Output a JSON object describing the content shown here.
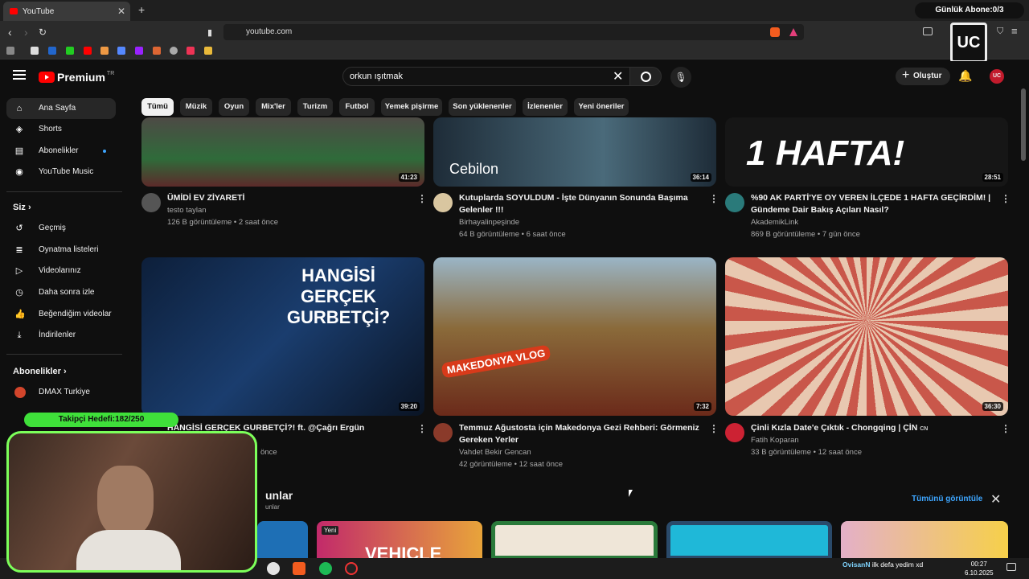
{
  "browser": {
    "tab_title": "YouTube",
    "new_tab": "+",
    "url": "youtube.com",
    "overlay_badge": "Günlük Abone:0/3"
  },
  "header": {
    "logo_text": "Premium",
    "logo_region": "TR",
    "search_value": "orkun ışıtmak",
    "create_label": "Oluştur",
    "avatar_text": "UC"
  },
  "chips": [
    "Tümü",
    "Müzik",
    "Oyun",
    "Mix'ler",
    "Turizm",
    "Futbol",
    "Yemek pişirme",
    "Son yüklenenler",
    "İzlenenler",
    "Yeni öneriler"
  ],
  "sidebar": {
    "main": [
      "Ana Sayfa",
      "Shorts",
      "Abonelikler",
      "YouTube Music"
    ],
    "you_header": "Siz",
    "you": [
      "Geçmiş",
      "Oynatma listeleri",
      "Videolarınız",
      "Daha sonra izle",
      "Beğendiğim videolar",
      "İndirilenler"
    ],
    "subs_header": "Abonelikler",
    "subs": [
      "DMAX Turkiye"
    ]
  },
  "videos": [
    {
      "title1": "ÜMİDİ EV ZİYARETİ",
      "title2": "",
      "channel": "testo taylan",
      "meta": "126 B görüntüleme • 2 saat önce",
      "duration": "41:23",
      "color": "#2f6b3a"
    },
    {
      "title1": "Kutuplarda SOYULDUM - İşte Dünyanın Sonunda Başıma",
      "title2": "Gelenler !!!",
      "channel": "Birhayalinpeşinde",
      "meta": "64 B görüntüleme • 6 saat önce",
      "duration": "36:14",
      "color": "#3c5666",
      "thumb_text": "Cebilon"
    },
    {
      "title1": "%90 AK PARTİ'YE OY VEREN İLÇEDE 1 HAFTA GEÇİRDİM! |",
      "title2": "Gündeme Dair Bakış Açıları Nasıl?",
      "channel": "AkademikLink",
      "meta": "869 B görüntüleme • 7 gün önce",
      "duration": "28:51",
      "color": "#111111",
      "thumb_text": "1 HAFTA!"
    },
    {
      "title1": "HANGİSİ GERÇEK GURBETÇİ?! ft. @Çağrı Ergün",
      "title2": "",
      "channel": "",
      "meta": "önce",
      "duration": "39:20",
      "color": "#1a3d6e",
      "thumb_text": "HANGİSİ GERÇEK GURBETÇİ?"
    },
    {
      "title1": "Temmuz Ağustosta için Makedonya Gezi Rehberi: Görmeniz",
      "title2": "Gereken Yerler",
      "channel": "Vahdet Bekir Gencan",
      "meta": "42 görüntüleme • 12 saat önce",
      "duration": "7:32",
      "color": "#8a6a3a",
      "thumb_text": "MAKEDONYA VLOG"
    },
    {
      "title1": "Çinli Kızla Date'e Çıktık - Chongqing | ÇİN",
      "title2": "",
      "channel": "Fatih Koparan",
      "meta": "33 B görüntüleme • 12 saat önce",
      "duration": "36:30",
      "color": "#c98a7a",
      "title_suffix": "CN"
    }
  ],
  "section": {
    "title": "unlar",
    "subtitle": "unlar",
    "show_all": "Tümünü görüntüle",
    "shorts_badge": "Yeni",
    "shorts_text": "VEHICLE"
  },
  "overlay": {
    "follower_goal": "Takipçi Hedefi:182/250",
    "chat_user": "OvisanN",
    "chat_msg": "ilk defa yedim xd"
  },
  "taskbar": {
    "time": "00:27",
    "date": "6.10.2025"
  }
}
